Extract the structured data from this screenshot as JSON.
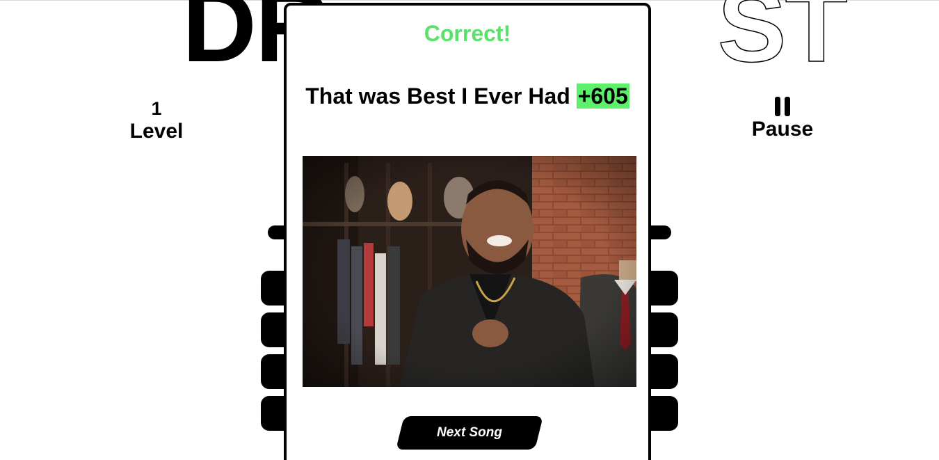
{
  "header": {
    "title_solid": "DR",
    "title_outline": "ST"
  },
  "level": {
    "value": "1",
    "label": "Level"
  },
  "pause": {
    "label": "Pause"
  },
  "modal": {
    "status": "Correct!",
    "message_prefix": "That was Best I Ever Had",
    "points": "+605",
    "next_label": "Next Song"
  },
  "colors": {
    "correct": "#5be06a",
    "points_highlight": "#5ef06a"
  },
  "icons": {
    "pause": "pause-icon"
  }
}
